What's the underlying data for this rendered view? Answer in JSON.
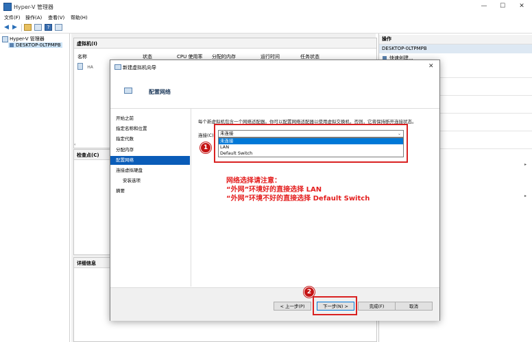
{
  "window": {
    "title": "Hyper-V 管理器",
    "min": "—",
    "max": "☐",
    "close": "✕"
  },
  "menu": [
    "文件(F)",
    "操作(A)",
    "查看(V)",
    "帮助(H)"
  ],
  "tree": {
    "root": "Hyper-V 管理器",
    "host": "DESKTOP-0LTPMPB"
  },
  "vm_panel": {
    "title": "虚拟机(I)",
    "columns": [
      "名称",
      "状态",
      "CPU 使用率",
      "分配的内存",
      "运行时间",
      "任务状态"
    ],
    "rows": [
      {
        "name": "HA"
      }
    ]
  },
  "checkpoint_panel": {
    "title": "检查点(C)"
  },
  "details_panel": {
    "title": "详细信息"
  },
  "actions": {
    "header": "操作",
    "host": "DESKTOP-0LTPMPB",
    "items": [
      "快速创建..."
    ]
  },
  "dialog": {
    "title": "新建虚拟机向导",
    "heading": "配置网络",
    "description": "每个新虚拟机包含一个网络适配器。你可以配置网络适配器以使用虚拟交换机，否则，它将保持断开连接状态。",
    "connection_label": "连接(C):",
    "connection_value": "未连接",
    "options": [
      "未连接",
      "LAN",
      "Default Switch"
    ],
    "steps": [
      {
        "label": "开始之前",
        "sub": false,
        "active": false
      },
      {
        "label": "指定名称和位置",
        "sub": false,
        "active": false
      },
      {
        "label": "指定代数",
        "sub": false,
        "active": false
      },
      {
        "label": "分配内存",
        "sub": false,
        "active": false
      },
      {
        "label": "配置网络",
        "sub": false,
        "active": true
      },
      {
        "label": "连接虚拟硬盘",
        "sub": false,
        "active": false
      },
      {
        "label": "安装选项",
        "sub": true,
        "active": false
      },
      {
        "label": "摘要",
        "sub": false,
        "active": false
      }
    ],
    "buttons": {
      "prev": "< 上一步(P)",
      "next": "下一步(N) >",
      "finish": "完成(F)",
      "cancel": "取消"
    }
  },
  "annotation": {
    "badge1": "1",
    "badge2": "2",
    "lines": [
      "网络选择请注意：",
      "“外网”环境好的直接选择  LAN",
      "“外网”环境不好的直接选择  Default Switch"
    ]
  },
  "colors": {
    "accent": "#0078d7",
    "annotation_red": "#e41d1d",
    "step_active": "#0a5cb8"
  }
}
